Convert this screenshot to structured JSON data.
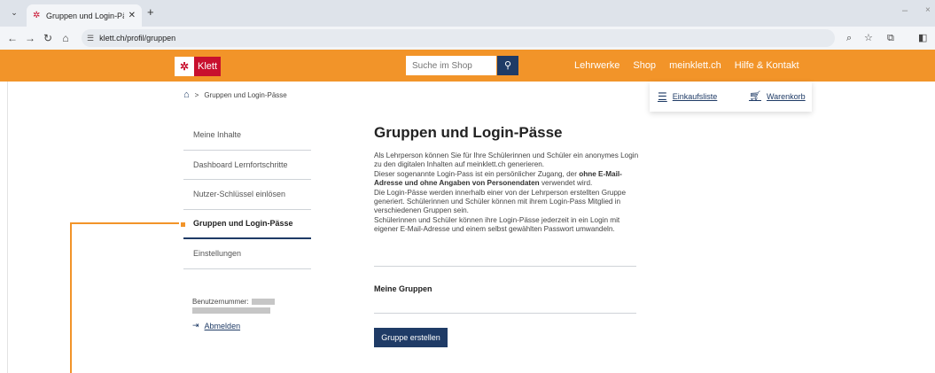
{
  "browser": {
    "tab_title": "Gruppen und Login-Pässe - Kle",
    "new_tab": "+",
    "url": "klett.ch/profil/gruppen"
  },
  "header": {
    "logo_text": "Klett",
    "search_placeholder": "Suche im Shop",
    "nav": [
      "Lehrwerke",
      "Shop",
      "meinklett.ch",
      "Hilfe & Kontakt"
    ]
  },
  "breadcrumb": {
    "separator": ">",
    "current": "Gruppen und Login-Pässe"
  },
  "shop_links": {
    "shopping_list": "Einkaufsliste",
    "cart": "Warenkorb"
  },
  "sidebar": {
    "items": [
      {
        "label": "Meine Inhalte"
      },
      {
        "label": "Dashboard Lernfortschritte"
      },
      {
        "label": "Nutzer-Schlüssel einlösen"
      },
      {
        "label": "Gruppen und Login-Pässe",
        "active": true
      },
      {
        "label": "Einstellungen"
      }
    ],
    "user_number_label": "Benutzernummer:",
    "logout_label": "Abmelden"
  },
  "main": {
    "title": "Gruppen und Login-Pässe",
    "para1": "Als Lehrperson können Sie für Ihre Schülerinnen und Schüler ein anonymes Login zu den digitalen Inhalten auf meinklett.ch generieren.",
    "para2_pre": "Dieser sogenannte Login-Pass ist ein persönlicher Zugang, der ",
    "para2_bold": "ohne E-Mail-Adresse und ohne Angaben von Personendaten",
    "para2_post": " verwendet wird.",
    "para3": "Die Login-Pässe werden innerhalb einer von der Lehrperson erstellten Gruppe generiert. Schülerinnen und Schüler können mit ihrem Login-Pass Mitglied in verschiedenen Gruppen sein.",
    "para4": "Schülerinnen und Schüler können ihre Login-Pässe jederzeit in ein Login mit eigener E-Mail-Adresse und einem selbst gewählten Passwort umwandeln.",
    "groups_heading": "Meine Gruppen",
    "create_button": "Gruppe erstellen"
  },
  "colors": {
    "header_orange": "#f29429",
    "navy": "#1f3b66",
    "brand_red": "#c8102e"
  }
}
